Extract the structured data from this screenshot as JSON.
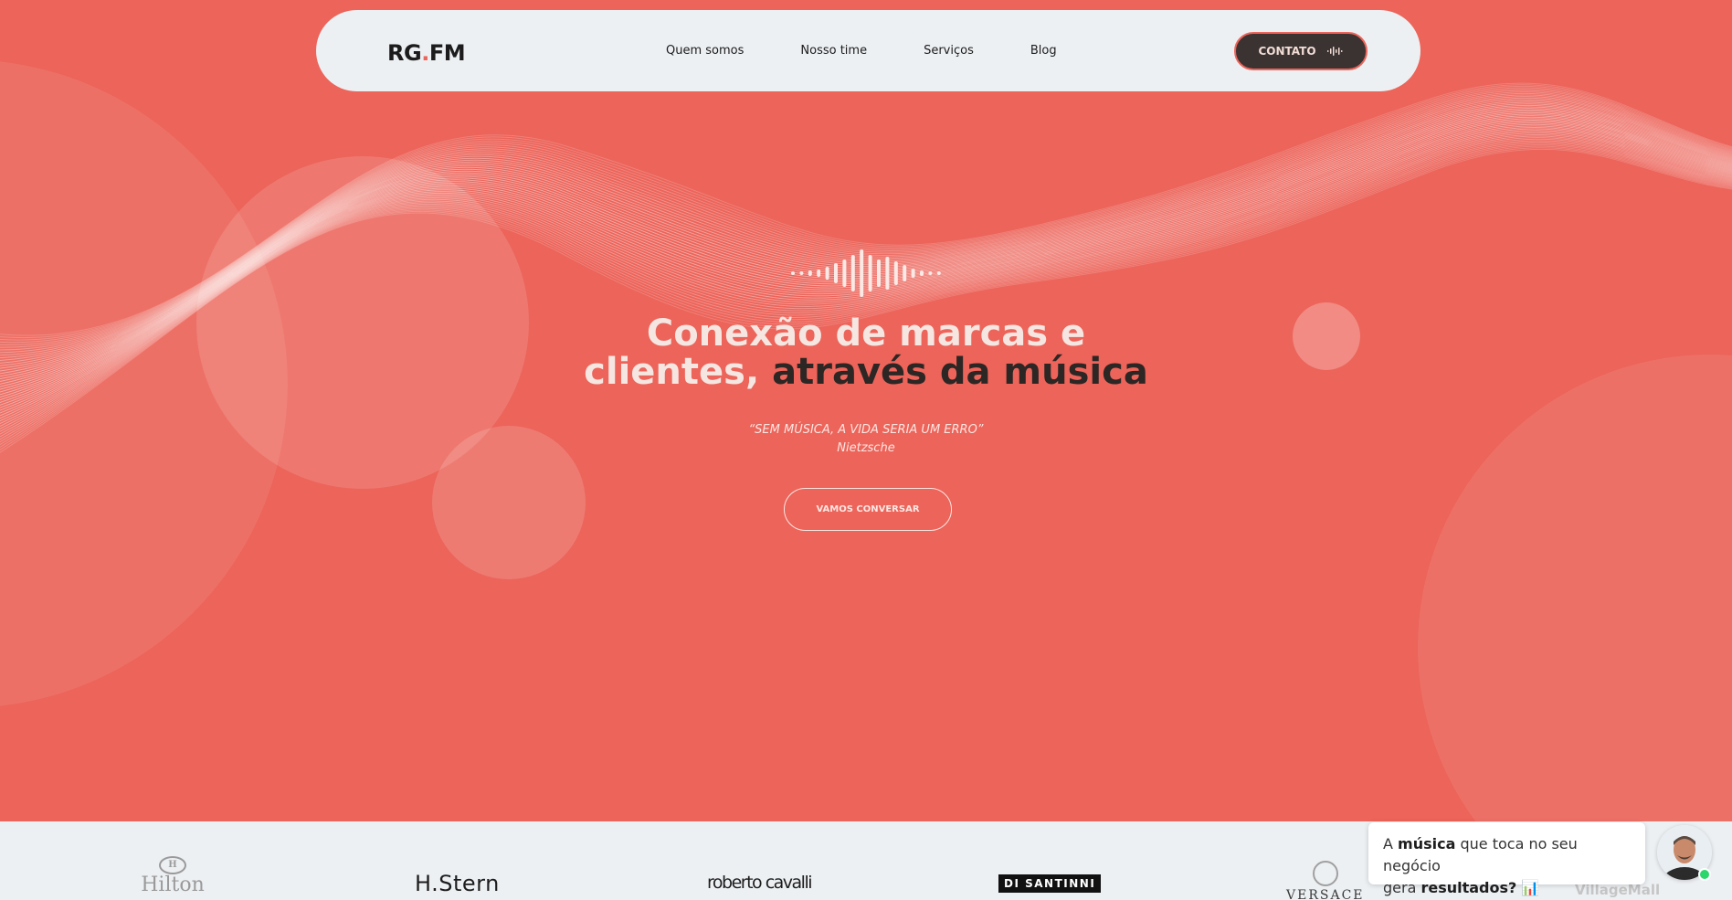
{
  "brand": {
    "logo_main": "RG",
    "logo_dot": ".",
    "logo_end": "FM"
  },
  "nav": {
    "items": [
      {
        "label": "Quem somos"
      },
      {
        "label": "Nosso time"
      },
      {
        "label": "Serviços"
      },
      {
        "label": "Blog"
      }
    ],
    "contact_label": "CONTATO",
    "contact_icon": "audio-wave-icon"
  },
  "hero": {
    "headline_part1": "Conexão de marcas e",
    "headline_part2": "clientes,",
    "headline_part3": "através da música",
    "quote": "“SEM MÚSICA, A VIDA SERIA UM ERRO”",
    "quote_author": "Nietzsche",
    "cta_label": "VAMOS CONVERSAR"
  },
  "clients": {
    "logos": [
      {
        "label": "Hilton",
        "mark": "H"
      },
      {
        "label": "H.Stern"
      },
      {
        "label": "roberto cavalli"
      },
      {
        "label": "DI SANTINNI"
      },
      {
        "label": "VERSACE"
      },
      {
        "label": "VillageMall"
      }
    ]
  },
  "chat": {
    "line1_a": "A ",
    "line1_b": "música",
    "line1_c": " que toca no seu negócio",
    "line2_a": "gera ",
    "line2_b": "resultados?",
    "line2_emoji": "📊"
  },
  "colors": {
    "accent": "#ec645a",
    "dark": "#2c2624",
    "light": "#edf0f3"
  }
}
